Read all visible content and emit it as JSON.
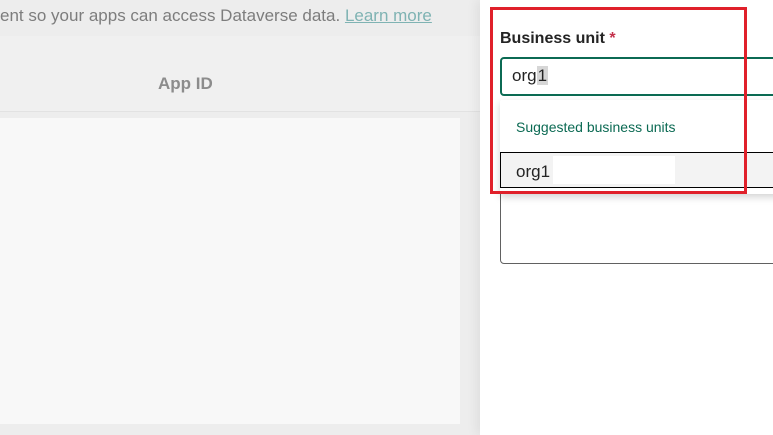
{
  "background_page": {
    "intro_text": "ent so your apps can access Dataverse data.",
    "learn_more_link": "Learn more",
    "table": {
      "columns": [
        "App ID"
      ]
    }
  },
  "side_panel": {
    "business_unit": {
      "label": "Business unit",
      "required_marker": "*",
      "input_value_prefix": "org",
      "input_value_selected": "1"
    },
    "suggestions": {
      "header": "Suggested business units",
      "options": [
        "org1"
      ]
    }
  },
  "colors": {
    "accent": "#0b6a53",
    "required": "#c4314b",
    "annotation_box": "#e0202a"
  }
}
